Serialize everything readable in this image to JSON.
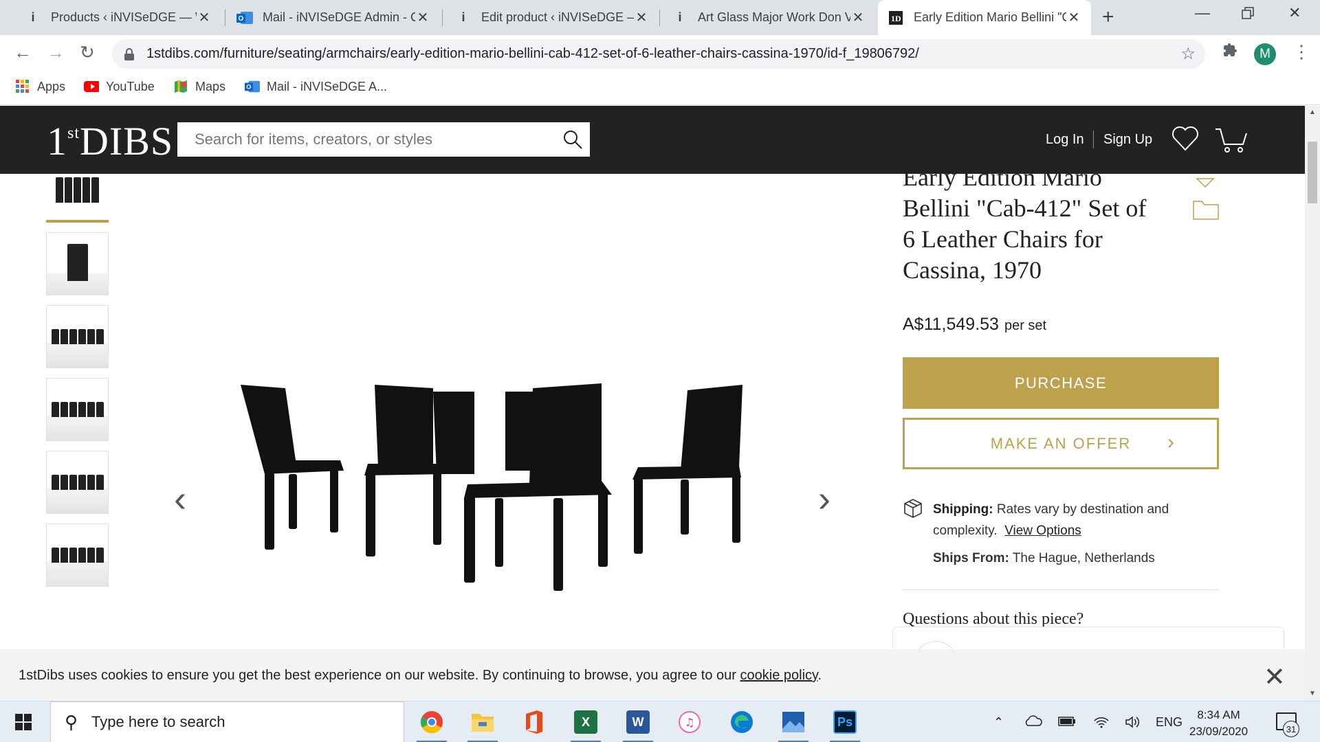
{
  "browser": {
    "tabs": [
      {
        "title": "Products ‹ iNVISeDGE — W",
        "icon": "info-icon"
      },
      {
        "title": "Mail - iNVISeDGE Admin - C",
        "icon": "outlook-icon"
      },
      {
        "title": "Edit product ‹ iNVISeDGE —",
        "icon": "info-icon"
      },
      {
        "title": "Art Glass Major Work Don V",
        "icon": "info-icon"
      },
      {
        "title": "Early Edition Mario Bellini \"C",
        "icon": "1stdibs-icon"
      }
    ],
    "url": "1stdibs.com/furniture/seating/armchairs/early-edition-mario-bellini-cab-412-set-of-6-leather-chairs-cassina-1970/id-f_19806792/",
    "profile_initial": "M",
    "bookmarks": [
      {
        "label": "Apps",
        "icon": "apps-grid-icon"
      },
      {
        "label": "YouTube",
        "icon": "youtube-icon"
      },
      {
        "label": "Maps",
        "icon": "maps-icon"
      },
      {
        "label": "Mail - iNVISeDGE A...",
        "icon": "outlook-icon"
      }
    ]
  },
  "site": {
    "logo": {
      "part1": "1",
      "part2": "st",
      "part3": "DIBS"
    },
    "search_placeholder": "Search for items, creators, or styles",
    "login": "Log In",
    "signup": "Sign Up"
  },
  "product": {
    "title": "Early Edition Mario Bellini \"Cab-412\" Set of 6 Leather Chairs for Cassina, 1970",
    "price": "A$11,549.53",
    "price_unit": "per set",
    "purchase_label": "PURCHASE",
    "offer_label": "MAKE AN OFFER",
    "shipping_label": "Shipping:",
    "shipping_text": "Rates vary by destination and complexity.",
    "view_options": "View Options",
    "ships_from_label": "Ships From:",
    "ships_from": "The Hague, Netherlands",
    "questions": "Questions about this piece?"
  },
  "cookie": {
    "text": "1stDibs uses cookies to ensure you get the best experience on our website. By continuing to browse, you agree to our",
    "link": "cookie policy",
    "period": "."
  },
  "taskbar": {
    "search_placeholder": "Type here to search",
    "language": "ENG",
    "time": "8:34 AM",
    "date": "23/09/2020",
    "notification_count": "31",
    "apps": [
      "chrome-icon",
      "file-explorer-icon",
      "office-icon",
      "excel-icon",
      "word-icon",
      "itunes-icon",
      "edge-icon",
      "photos-icon",
      "photoshop-icon"
    ]
  },
  "colors": {
    "accent": "#bda14c",
    "header_bg": "#222222"
  }
}
